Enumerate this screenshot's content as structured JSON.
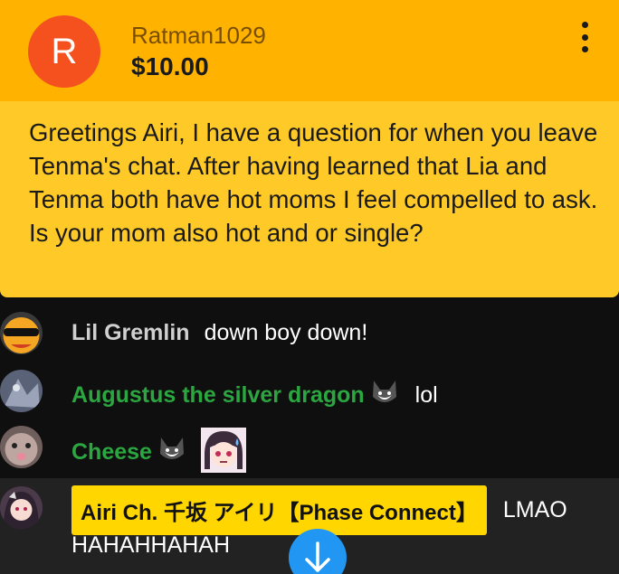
{
  "superchat": {
    "avatar_letter": "R",
    "author": "Ratman1029",
    "amount": "$10.00",
    "message": "Greetings Airi, I have a question for when you leave Tenma's chat. After having learned that Lia and Tenma both have hot moms I feel compelled to ask. Is your mom also hot and or single?",
    "colors": {
      "header": "#ffb300",
      "body": "#ffca28",
      "avatar": "#f4511e"
    }
  },
  "messages": [
    {
      "author": "Lil Gremlin",
      "text": "down boy down!",
      "author_color": "#d0d0d0"
    },
    {
      "author": "Augustus the silver dragon",
      "text": "lol",
      "author_color": "#2ba640"
    },
    {
      "author": "Cheese",
      "text": "",
      "author_color": "#2ba640"
    },
    {
      "author": "Airi Ch. 千坂 アイリ【Phase Connect】",
      "text_line1": "LMAO",
      "text_line2": "HAHAHHAHAH",
      "author_color": "#111111"
    }
  ],
  "icons": {
    "menu": "more-vert-icon",
    "scroll": "arrow-down-icon",
    "emote": "wolf-emote-icon"
  }
}
